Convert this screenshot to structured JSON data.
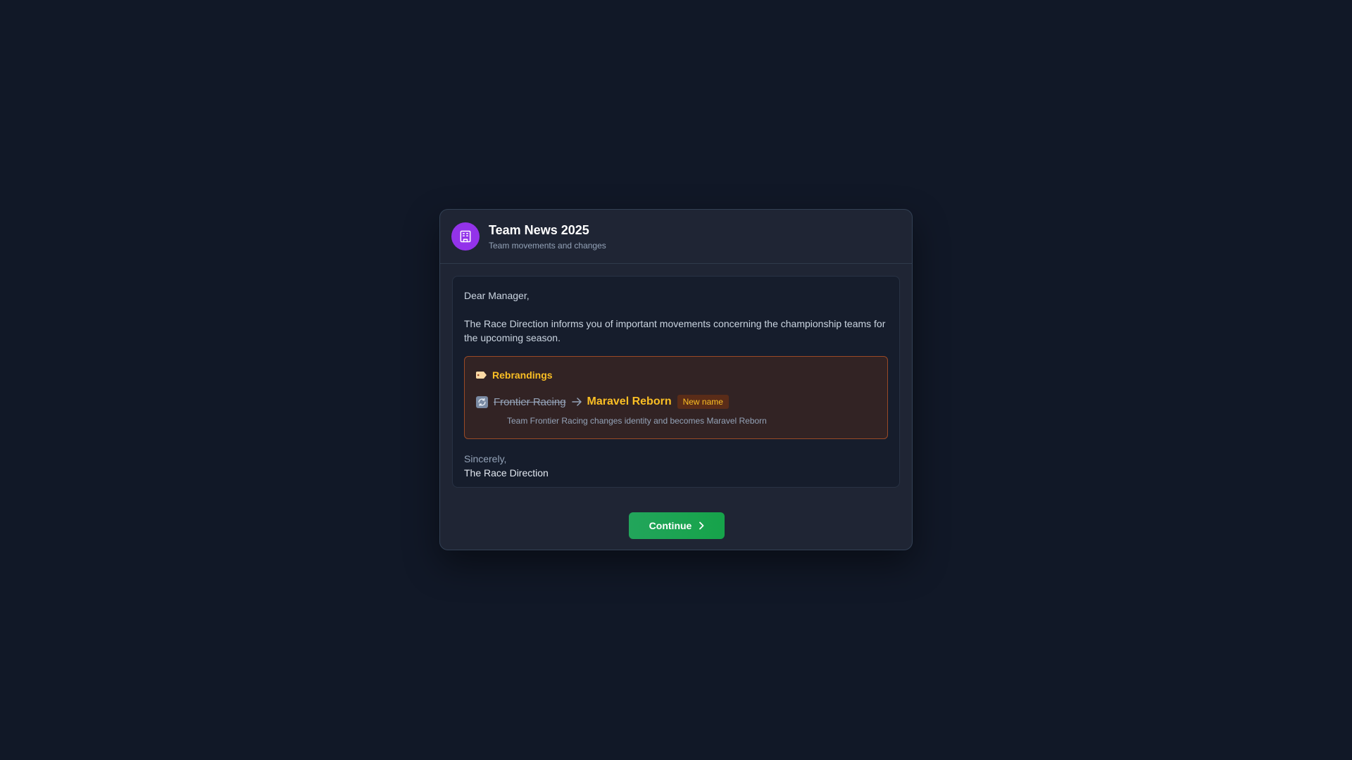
{
  "dialog": {
    "title": "Team News 2025",
    "subtitle": "Team movements and changes",
    "avatar_icon": "building-icon",
    "avatar_color": "#9333ea"
  },
  "letter": {
    "greeting": "Dear Manager,",
    "intro": "The Race Direction informs you of important movements concerning the championship teams for the upcoming season.",
    "rebrandings": {
      "heading": "Rebrandings",
      "heading_icon": "tag-icon",
      "items": [
        {
          "icon": "refresh-icon",
          "old_name": "Frontier Racing",
          "new_name": "Maravel Reborn",
          "badge": "New name",
          "description": "Team Frontier Racing changes identity and becomes Maravel Reborn"
        }
      ]
    },
    "closing": "Sincerely,",
    "signature": "The Race Direction"
  },
  "actions": {
    "continue_label": "Continue"
  },
  "colors": {
    "accent_warning": "#fbbf24",
    "accent_success": "#16a34a",
    "background": "#111827"
  }
}
